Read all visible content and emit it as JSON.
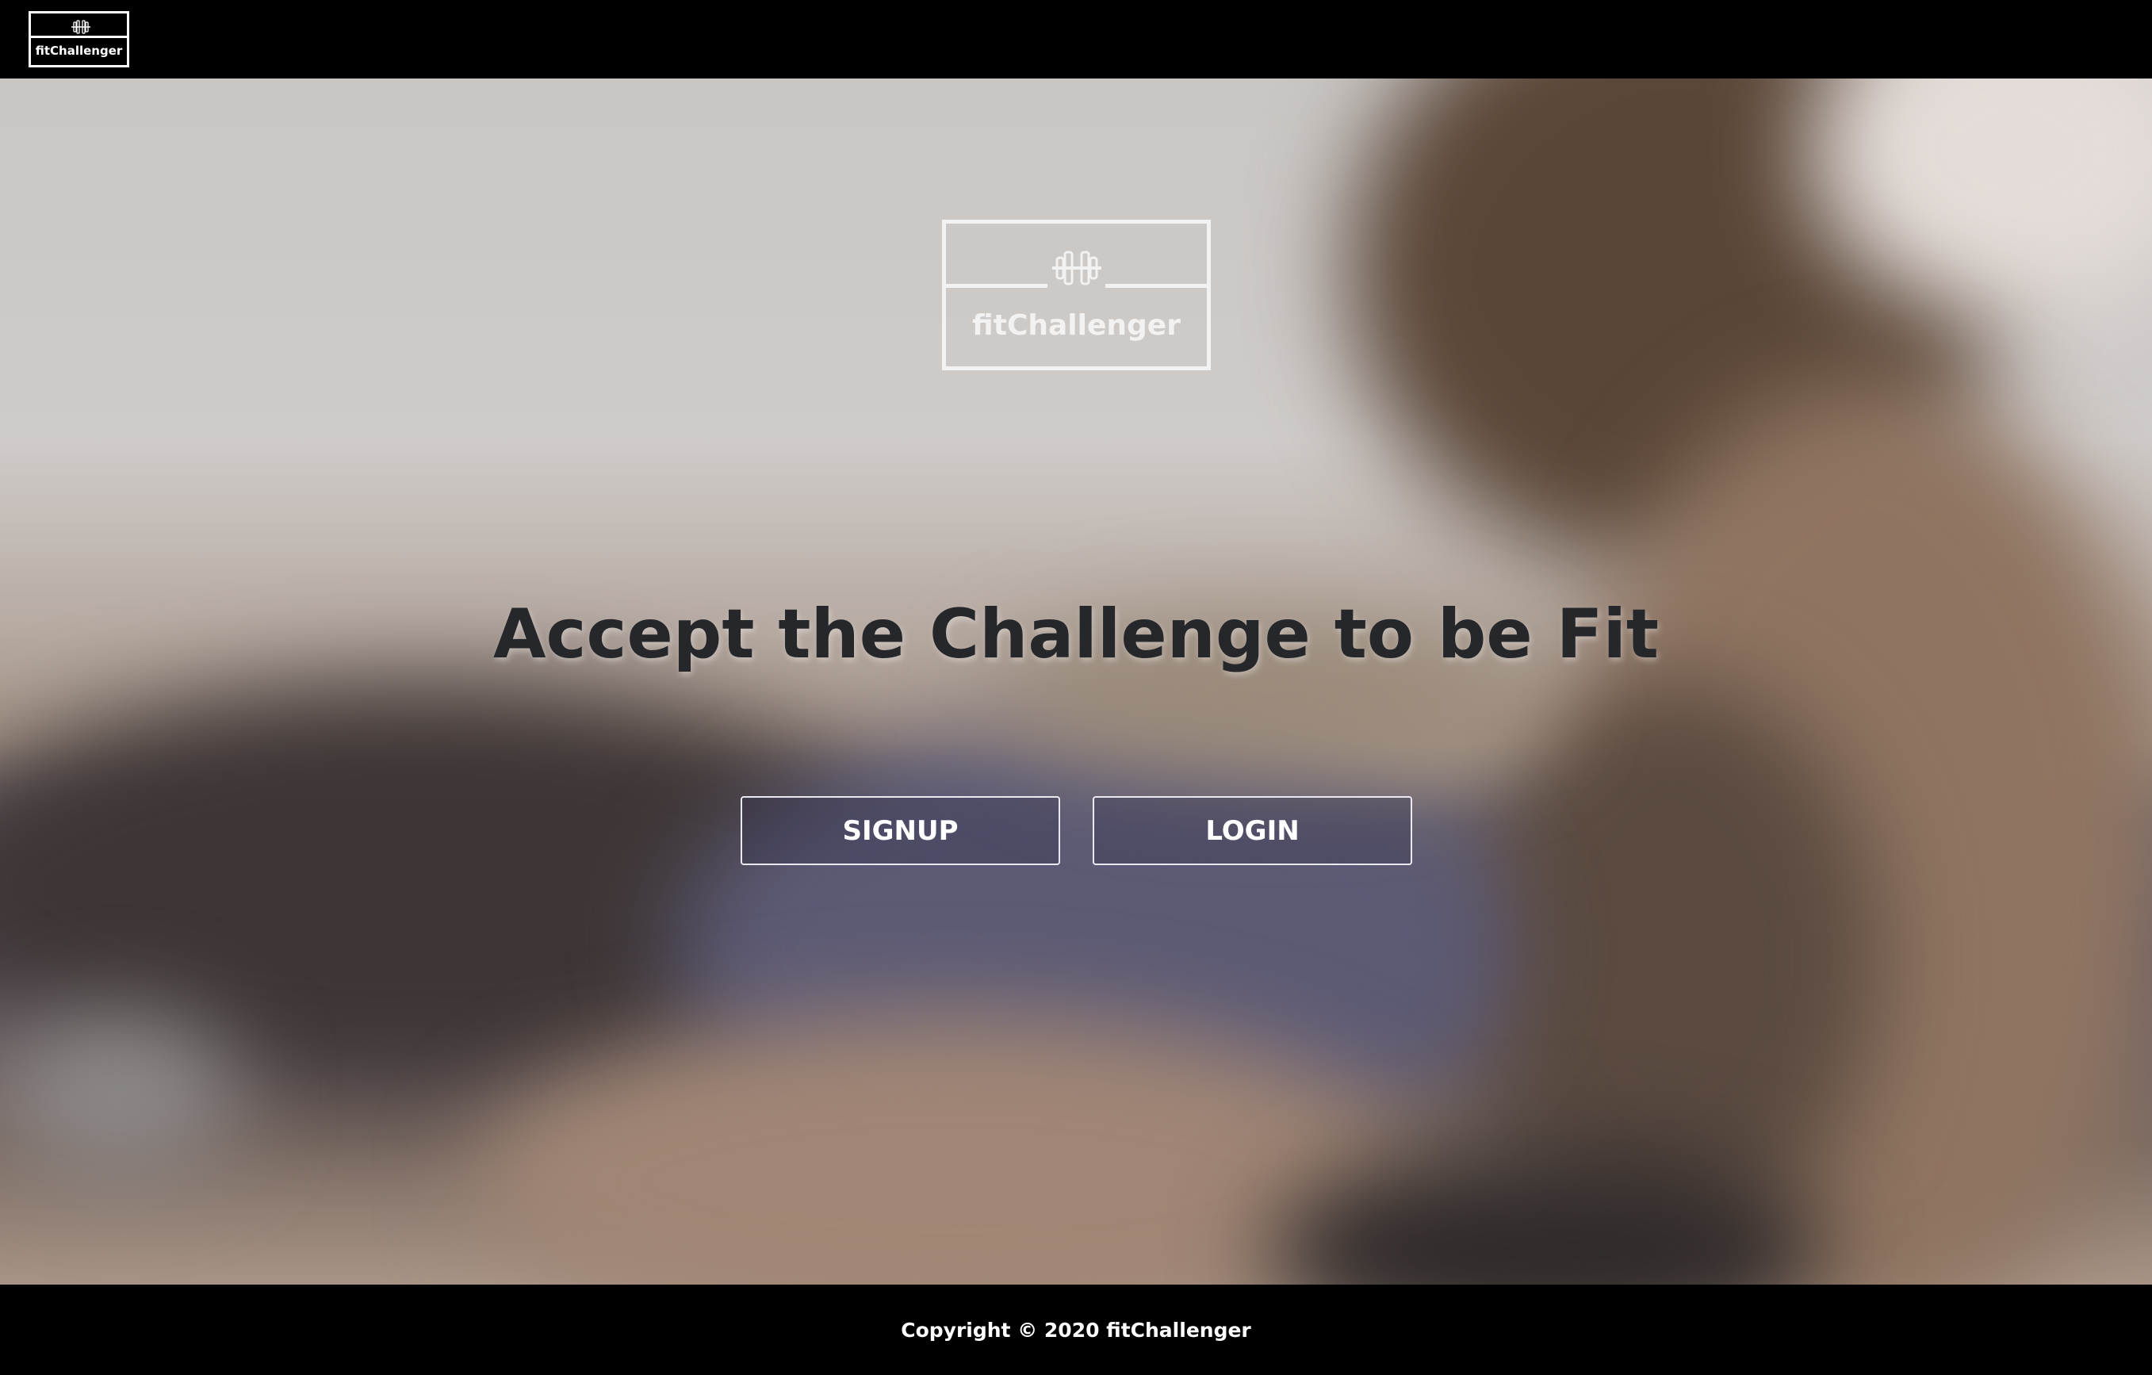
{
  "navbar": {
    "logo_text": "fitChallenger",
    "logo_icon": "dumbbell-icon"
  },
  "hero": {
    "logo_text": "fitChallenger",
    "logo_icon": "dumbbell-icon",
    "headline": "Accept the Challenge to be Fit",
    "signup_label": "SIGNUP",
    "login_label": "LOGIN"
  },
  "footer": {
    "copyright": "Copyright © 2020 fitChallenger"
  },
  "colors": {
    "bar_background": "#000000",
    "headline": "#26272b",
    "button_border": "#e9e9ef",
    "logo_stroke": "#f2f2f2"
  }
}
